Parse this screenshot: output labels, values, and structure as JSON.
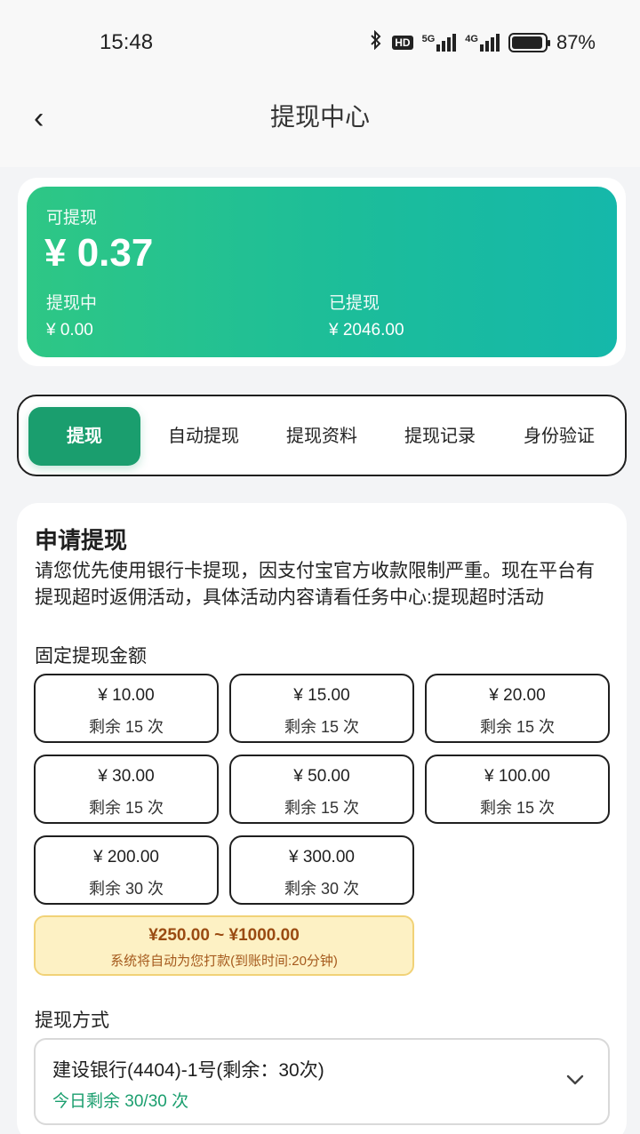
{
  "status_bar": {
    "time": "15:48",
    "icons": [
      "bluetooth-icon",
      "hd-icon",
      "5g-signal-icon",
      "4g-signal-icon",
      "battery-icon"
    ],
    "hd": "HD",
    "net5g": "5G",
    "net4g": "4G",
    "battery": "87%"
  },
  "header": {
    "back": "‹",
    "title": "提现中心"
  },
  "balance": {
    "available_label": "可提现",
    "available_amount": "¥ 0.37",
    "pending_label": "提现中",
    "pending_amount": "¥ 0.00",
    "withdrawn_label": "已提现",
    "withdrawn_amount": "¥ 2046.00",
    "colors": {
      "gradient_start": "#2ec785",
      "gradient_end": "#15b8aa"
    }
  },
  "tabs": [
    {
      "label": "提现",
      "active": true
    },
    {
      "label": "自动提现",
      "active": false
    },
    {
      "label": "提现资料",
      "active": false
    },
    {
      "label": "提现记录",
      "active": false
    },
    {
      "label": "身份验证",
      "active": false
    }
  ],
  "apply": {
    "title": "申请提现",
    "description": "请您优先使用银行卡提现，因支付宝官方收款限制严重。现在平台有提现超时返佣活动，具体活动内容请看任务中心:提现超时活动",
    "fixed_label": "固定提现金额",
    "amounts": [
      {
        "value": "¥ 10.00",
        "remaining": "剩余 15 次"
      },
      {
        "value": "¥ 15.00",
        "remaining": "剩余 15 次"
      },
      {
        "value": "¥ 20.00",
        "remaining": "剩余 15 次"
      },
      {
        "value": "¥ 30.00",
        "remaining": "剩余 15 次"
      },
      {
        "value": "¥ 50.00",
        "remaining": "剩余 15 次"
      },
      {
        "value": "¥ 100.00",
        "remaining": "剩余 15 次"
      },
      {
        "value": "¥ 200.00",
        "remaining": "剩余 30 次"
      },
      {
        "value": "¥ 300.00",
        "remaining": "剩余 30 次"
      }
    ],
    "range": {
      "text": "¥250.00 ~ ¥1000.00",
      "note": "系统将自动为您打款(到账时间:20分钟)"
    },
    "method_label": "提现方式",
    "method": {
      "selected": "建设银行(4404)-1号(剩余：30次)",
      "today_remaining": "今日剩余 30/30 次",
      "icon": "chevron-down-icon"
    }
  },
  "accent_color": "#1a9e6e"
}
